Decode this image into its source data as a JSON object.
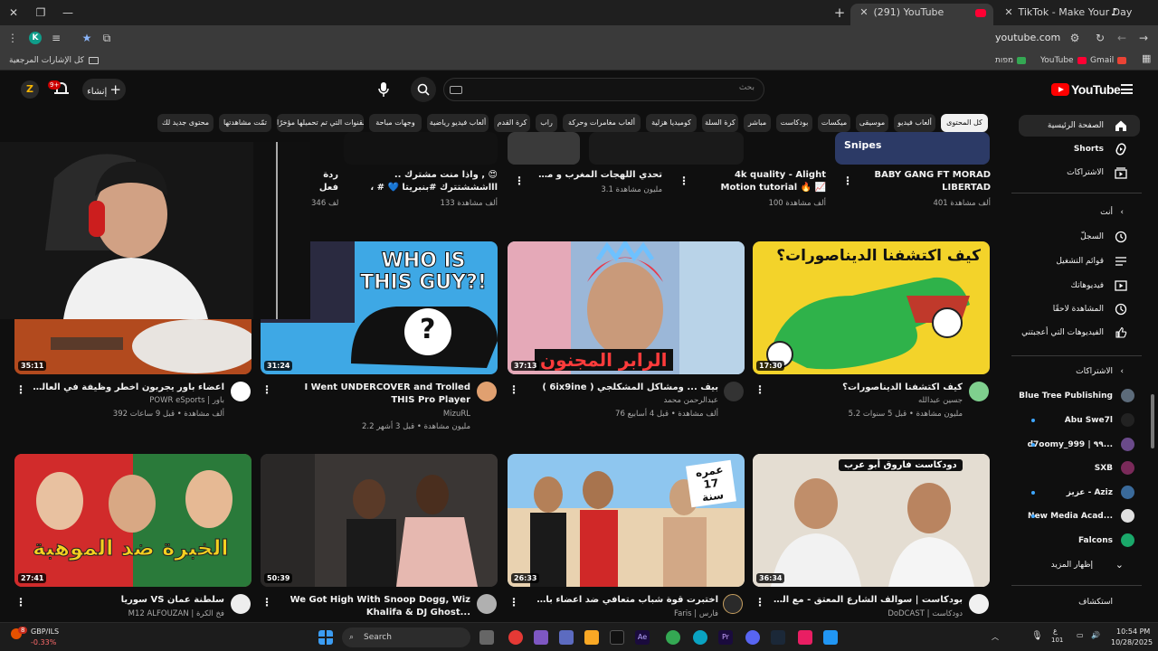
{
  "browser": {
    "tabs": [
      {
        "title": "(291) YouTube",
        "active": true
      },
      {
        "title": "TikTok - Make Your Day",
        "active": false
      }
    ],
    "url": "youtube.com",
    "profile_initial": "K",
    "bookmarks": [
      {
        "label": "Gmail"
      },
      {
        "label": "YouTube"
      },
      {
        "label": "מפות"
      }
    ],
    "bookmarks_folder": "كل الإشارات المرجعية"
  },
  "youtube": {
    "logo_text": "YouTube",
    "search_placeholder": "بحث",
    "create_label": "إنشاء",
    "notif_count": "9+",
    "avatar_letter": "Z",
    "chips": [
      "كل المحتوى",
      "ألعاب فيديو",
      "موسيقى",
      "ميكسات",
      "بودكاست",
      "مباشر",
      "كرة السلة",
      "كوميديا هزلية",
      "ألعاب مغامرات وحركة",
      "راب",
      "كرة القدم",
      "ألعاب فيديو رياضية",
      "وجهات مباحة",
      "القنوات التي تم تحميلها مؤخرًا",
      "تمّت مشاهدتها",
      "محتوى جديد لك"
    ],
    "sidebar": {
      "main": [
        {
          "label": "الصفحة الرئيسية",
          "icon": "home-icon"
        },
        {
          "label": "Shorts",
          "icon": "shorts-icon"
        },
        {
          "label": "الاشتراكات",
          "icon": "subscriptions-icon"
        }
      ],
      "you_heading": "أنت",
      "you": [
        {
          "label": "السجلّ",
          "icon": "history-icon"
        },
        {
          "label": "قوائم التشغيل",
          "icon": "playlist-icon"
        },
        {
          "label": "فيديوهاتك",
          "icon": "your-videos-icon"
        },
        {
          "label": "المشاهدة لاحقًا",
          "icon": "watch-later-icon"
        },
        {
          "label": "الفيديوهات التي أعجبتني",
          "icon": "like-icon"
        }
      ],
      "subs_heading": "الاشتراكات",
      "subscriptions": [
        {
          "label": "Blue Tree Publishing",
          "color": "#5c6b7a",
          "dot": false
        },
        {
          "label": "Abu Swe7l",
          "color": "#222222",
          "dot": true
        },
        {
          "label": "d7oomy_999 | ٩٩...",
          "color": "#6a4a8a",
          "dot": true
        },
        {
          "label": "SXB",
          "color": "#7a2a5a",
          "dot": false
        },
        {
          "label": "عزيز - Aziz",
          "color": "#3a6a9a",
          "dot": true
        },
        {
          "label": "New Media Acad...",
          "color": "#e0e0e0",
          "dot": true
        },
        {
          "label": "Falcons",
          "color": "#1aa86a",
          "dot": false
        }
      ],
      "show_more": "إظهار المزيد",
      "explore_heading": "استكشاف"
    },
    "top_row": [
      {
        "title": "BABY GANG FT MORAD LIBERTAD",
        "meta": "401 ألف مشاهدة"
      },
      {
        "title": "4k quality - Alight Motion tutorial 🔥 📈",
        "meta": "100 ألف مشاهدة"
      },
      {
        "title": "تحدي اللهجات المغرب و مصر MAEG",
        "meta": "3.1 مليون مشاهدة"
      },
      {
        "title": "😍 , واذا منت مشترك .. اااشششتترك #بنبريتا 💙 # ، #قالكرز #ةلكي...",
        "meta": "133 ألف مشاهدة"
      },
      {
        "title": "ردة فعل ... #اكسبلو#",
        "meta": "346 ألف"
      }
    ],
    "videos": [
      {
        "title": "كيف اكتشفنا الديناصورات؟",
        "channel": "جسين عبدالله",
        "meta": "5.2 مليون مشاهدة • قبل 5 سنوات",
        "duration": "17:30",
        "thumb_text": "كيف اكتشفنا الديناصورات؟",
        "verified": true
      },
      {
        "title": "بيف ... ومشاكل المشكلجي ( 6ix9ine )",
        "channel": "عبدالرحمن محمد",
        "meta": "76 ألف مشاهدة • قبل 4 أسابيع",
        "duration": "37:13",
        "thumb_text": "الرابر المجنون",
        "verified": false
      },
      {
        "title": "I Went UNDERCOVER and Trolled THIS Pro Player",
        "channel": "MizuRL",
        "meta": "2.2 مليون مشاهدة • قبل 3 أشهر",
        "duration": "31:24",
        "thumb_text": "WHO IS THIS GUY?!",
        "verified": true
      },
      {
        "title": "اعضاء باور يجربون اخطر وظيفة في العالم! ( المطافي ) 🇺🇸",
        "channel": "POWR eSports | باور",
        "meta": "392 ألف مشاهدة • قبل 9 ساعات",
        "duration": "35:11",
        "thumb_text": "",
        "verified": false
      },
      {
        "title": "بودكاست | سوالف الشارع المعتق - مع الرابر فاروق أبو عرب",
        "channel": "DoDCAST | دودكاست",
        "meta": "",
        "duration": "36:34",
        "thumb_text": "دودكاست  فاروق أبو عرب",
        "verified": true
      },
      {
        "title": "اختبرت قوة شباب متعافي ضد اعضاء باور !",
        "channel": "Faris | فارس",
        "meta": "",
        "duration": "26:33",
        "thumb_text": "عمره 17 سنة",
        "verified": true
      },
      {
        "title": "We Got High With Snoop Dogg, Wiz Khalifa & DJ Ghost...",
        "channel": "",
        "meta": "",
        "duration": "50:39",
        "thumb_text": "",
        "verified": false
      },
      {
        "title": "سلطنة عمان VS سوريا",
        "channel": "M12 ALFOUZAN | فخ الكرة",
        "meta": "",
        "duration": "27:41",
        "thumb_text": "الخبرة ضد الموهبة",
        "verified": false
      }
    ]
  },
  "taskbar": {
    "weather_label": "GBP/ILS",
    "weather_value": "-0.33%",
    "weather_badge": "8",
    "search_placeholder": "Search",
    "time": "10:54 PM",
    "date": "10/28/2025",
    "lang": "ع",
    "lang_sub": "101"
  }
}
